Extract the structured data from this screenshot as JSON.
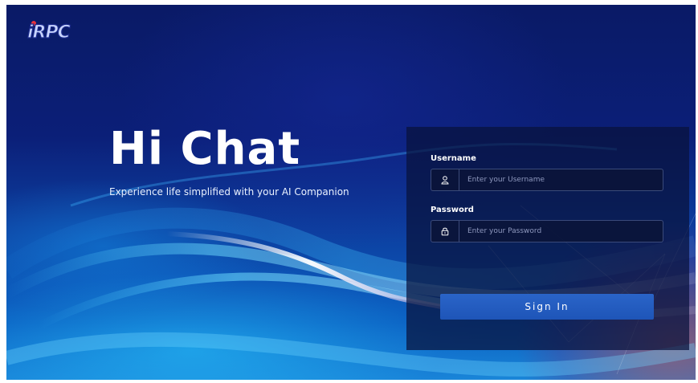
{
  "brand": {
    "logo_text": "iRPC"
  },
  "hero": {
    "title": "Hi Chat",
    "subtitle": "Experience life simplified with your AI Companion"
  },
  "login": {
    "username_label": "Username",
    "username_placeholder": "Enter your Username",
    "username_icon": "user-icon",
    "password_label": "Password",
    "password_placeholder": "Enter your Password",
    "password_icon": "lock-icon",
    "signin_label": "Sign In"
  },
  "colors": {
    "button": "#1e55b8",
    "background_top": "#0a1a66",
    "background_bottom": "#1a86d8"
  }
}
